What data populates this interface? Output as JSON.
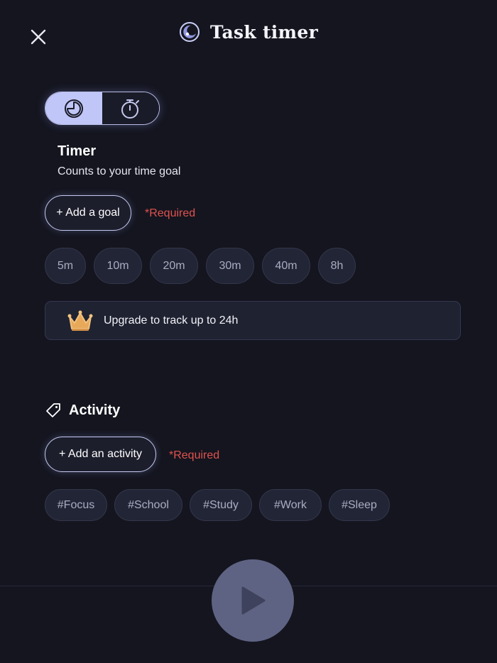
{
  "header": {
    "title": "Task timer",
    "close_icon": "close-icon",
    "logo_icon": "moon-logo-icon"
  },
  "mode_toggle": {
    "options": [
      {
        "icon": "pie-clock-icon",
        "selected": true
      },
      {
        "icon": "stopwatch-icon",
        "selected": false
      }
    ]
  },
  "timer": {
    "title": "Timer",
    "subtitle": "Counts to your time goal",
    "add_goal_label": "+ Add a goal",
    "required_label": "*Required",
    "presets": [
      "5m",
      "10m",
      "20m",
      "30m",
      "40m",
      "8h"
    ]
  },
  "upgrade": {
    "icon": "crown-icon",
    "text": "Upgrade to track up to 24h"
  },
  "activity": {
    "icon": "tag-icon",
    "title": "Activity",
    "add_activity_label": "+ Add an activity",
    "required_label": "*Required",
    "tags": [
      "#Focus",
      "#School",
      "#Study",
      "#Work",
      "#Sleep"
    ]
  },
  "play": {
    "icon": "play-icon"
  },
  "colors": {
    "background": "#14151f",
    "accent": "#c0c6f7",
    "required": "#e0524e",
    "chip": "#222536",
    "play": "#5f6383"
  }
}
